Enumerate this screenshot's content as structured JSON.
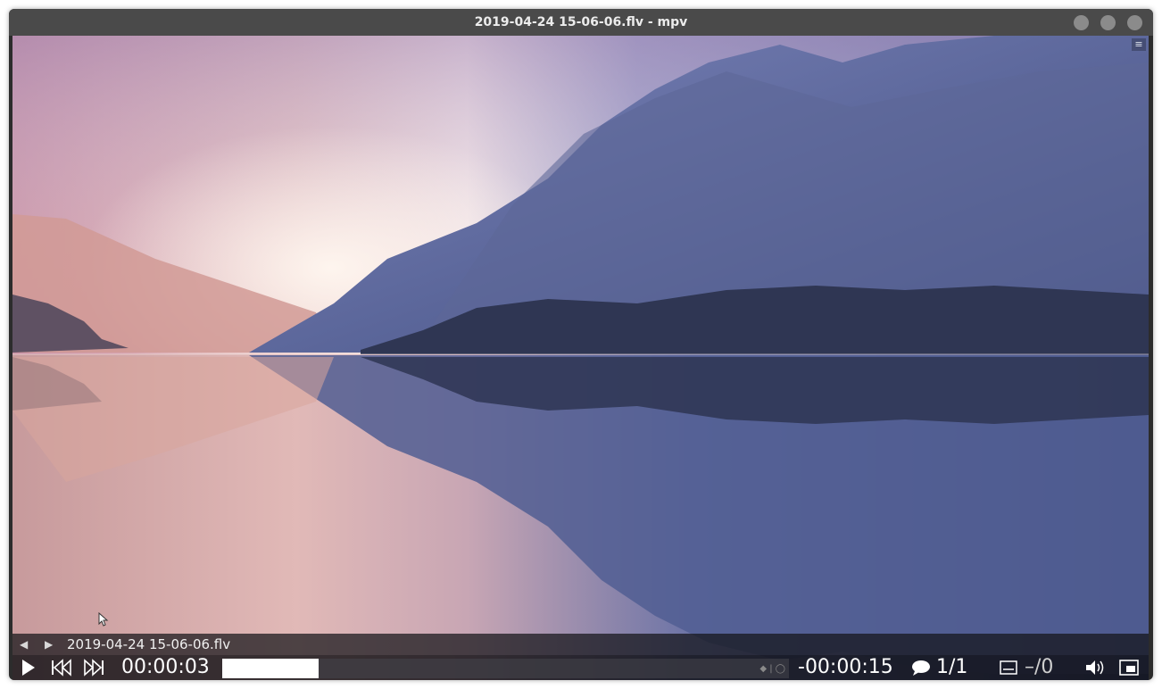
{
  "window": {
    "title": "2019-04-24 15-06-06.flv - mpv"
  },
  "titlebar_buttons": [
    "minimize",
    "maximize",
    "close"
  ],
  "colors": {
    "titlebar": "#4a4a4a",
    "osc_background": "#141418",
    "seek_fill": "#ffffff"
  },
  "overlay": {
    "menu_icon": "hamburger-icon"
  },
  "osc": {
    "playlist_prev_icon": "triangle-left-icon",
    "playlist_next_icon": "triangle-right-icon",
    "filename": "2019-04-24 15-06-06.flv",
    "play_icon": "play-icon",
    "skip_back_icon": "skip-back-icon",
    "skip_forward_icon": "skip-forward-icon",
    "elapsed": "00:00:03",
    "remaining": "-00:00:15",
    "progress_fraction": 0.17,
    "subtitle_icon": "speech-bubble-icon",
    "subtitle_track": "1/1",
    "audio_track": "–/0",
    "volume_icon": "speaker-icon",
    "fullscreen_icon": "window-icon"
  }
}
